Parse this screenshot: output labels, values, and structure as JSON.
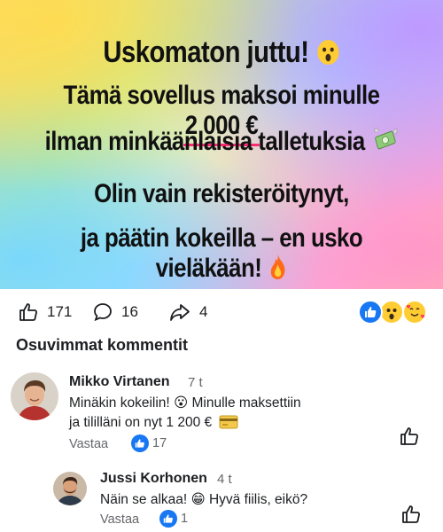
{
  "post": {
    "line1": "Uskomaton juttu!",
    "line2_prefix": "Tämä sovellus maksoi minulle",
    "line2_amount": "2 000 €",
    "line3": "ilman minkäänlaisia talletuksia",
    "line4": "Olin vain rekisteröitynyt,",
    "line5": "ja päätin kokeilla – en usko vieläkään!",
    "emoji_line1": "astonished-face-icon",
    "emoji_line3": "money-with-wings-icon",
    "emoji_line5": "fire-icon"
  },
  "stats": {
    "likes": "171",
    "comments": "16",
    "shares": "4",
    "reaction_icons": [
      "like-reaction-icon",
      "wow-reaction-icon",
      "love-reaction-icon"
    ]
  },
  "comments_section": {
    "title": "Osuvimmat kommentit",
    "comments": [
      {
        "author": "Mikko Virtanen",
        "time": "7 t",
        "line1": "Minäkin kokeilin! 😮 Minulle maksettiin",
        "line2": "ja tililläni on nyt 1 200 €",
        "reply_label": "Vastaa",
        "likes": "17"
      },
      {
        "author": "Jussi Korhonen",
        "time": "4 t",
        "line1": "Näin se alkaa! 😁 Hyvä fiilis, eikö?",
        "reply_label": "Vastaa",
        "likes": "1"
      }
    ]
  },
  "colors": {
    "accent": "#1877f2",
    "underline": "#ff2a72",
    "muted": "#65676b",
    "text": "#1c1e21"
  }
}
